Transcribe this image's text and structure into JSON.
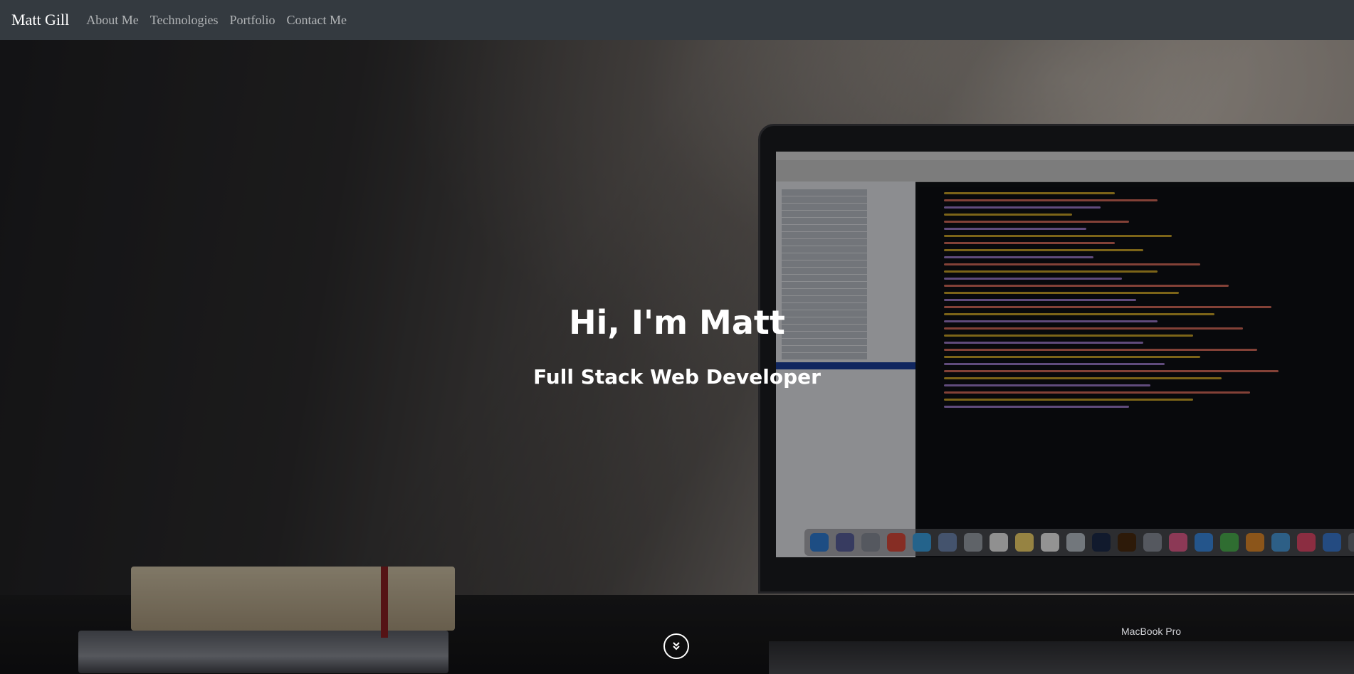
{
  "navbar": {
    "brand": "Matt Gill",
    "links": [
      {
        "label": "About Me"
      },
      {
        "label": "Technologies"
      },
      {
        "label": "Portfolio"
      },
      {
        "label": "Contact Me"
      }
    ]
  },
  "hero": {
    "title": "Hi, I'm Matt",
    "subtitle": "Full Stack Web Developer",
    "scroll_icon": "chevron-double-down-icon",
    "laptop_label": "MacBook Pro"
  },
  "colors": {
    "navbar_bg": "#343a40",
    "nav_link": "rgba(255,255,255,0.62)",
    "text": "#ffffff"
  }
}
